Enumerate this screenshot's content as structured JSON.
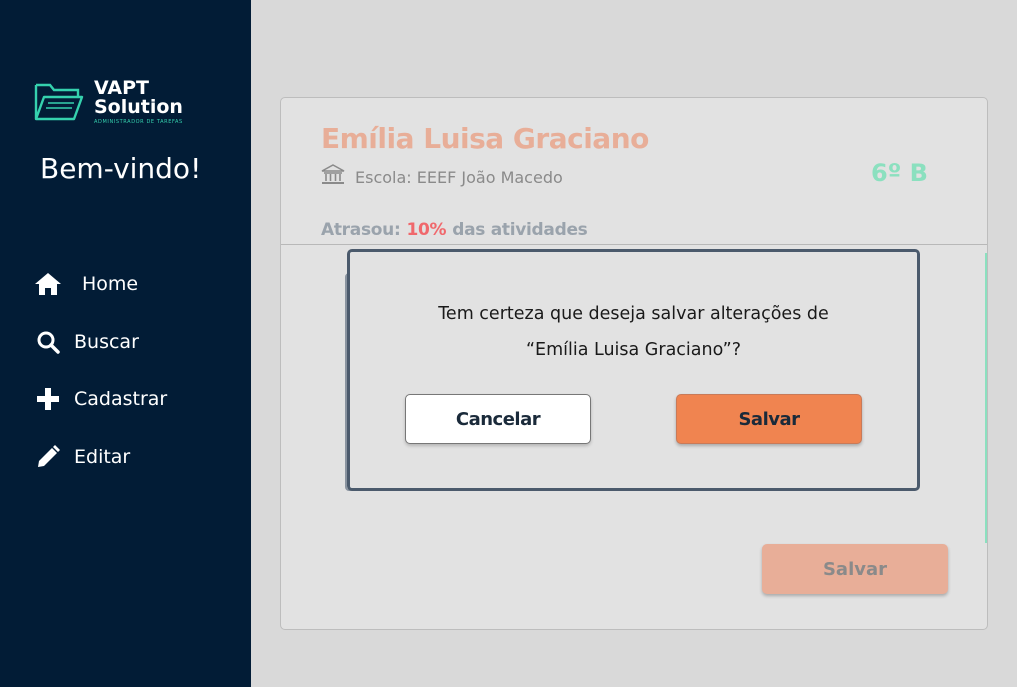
{
  "sidebar": {
    "logo": {
      "title_line1": "VAPT",
      "title_line2": "Solution",
      "subtitle": "ADMINISTRADOR DE TAREFAS"
    },
    "welcome": "Bem-vindo!",
    "items": [
      {
        "label": "Home",
        "icon": "home-icon"
      },
      {
        "label": "Buscar",
        "icon": "search-icon"
      },
      {
        "label": "Cadastrar",
        "icon": "plus-icon"
      },
      {
        "label": "Editar",
        "icon": "pencil-icon"
      }
    ]
  },
  "student": {
    "name": "Emília Luisa Graciano",
    "school": "Escola: EEEF João Macedo",
    "class": "6º B",
    "late_label": "Atrasou:",
    "late_pct": "10%",
    "late_suffix": "das atividades"
  },
  "card": {
    "save_label": "Salvar"
  },
  "modal": {
    "line1": "Tem certeza que deseja salvar alterações de",
    "line2": "“Emília Luisa Graciano”?",
    "cancel_label": "Cancelar",
    "save_label": "Salvar"
  },
  "colors": {
    "sidebar_bg": "#021c36",
    "accent_teal": "#35d1ae",
    "accent_orange": "#f08450",
    "name_salmon": "#e8ae98",
    "late_red": "#f0686c"
  }
}
